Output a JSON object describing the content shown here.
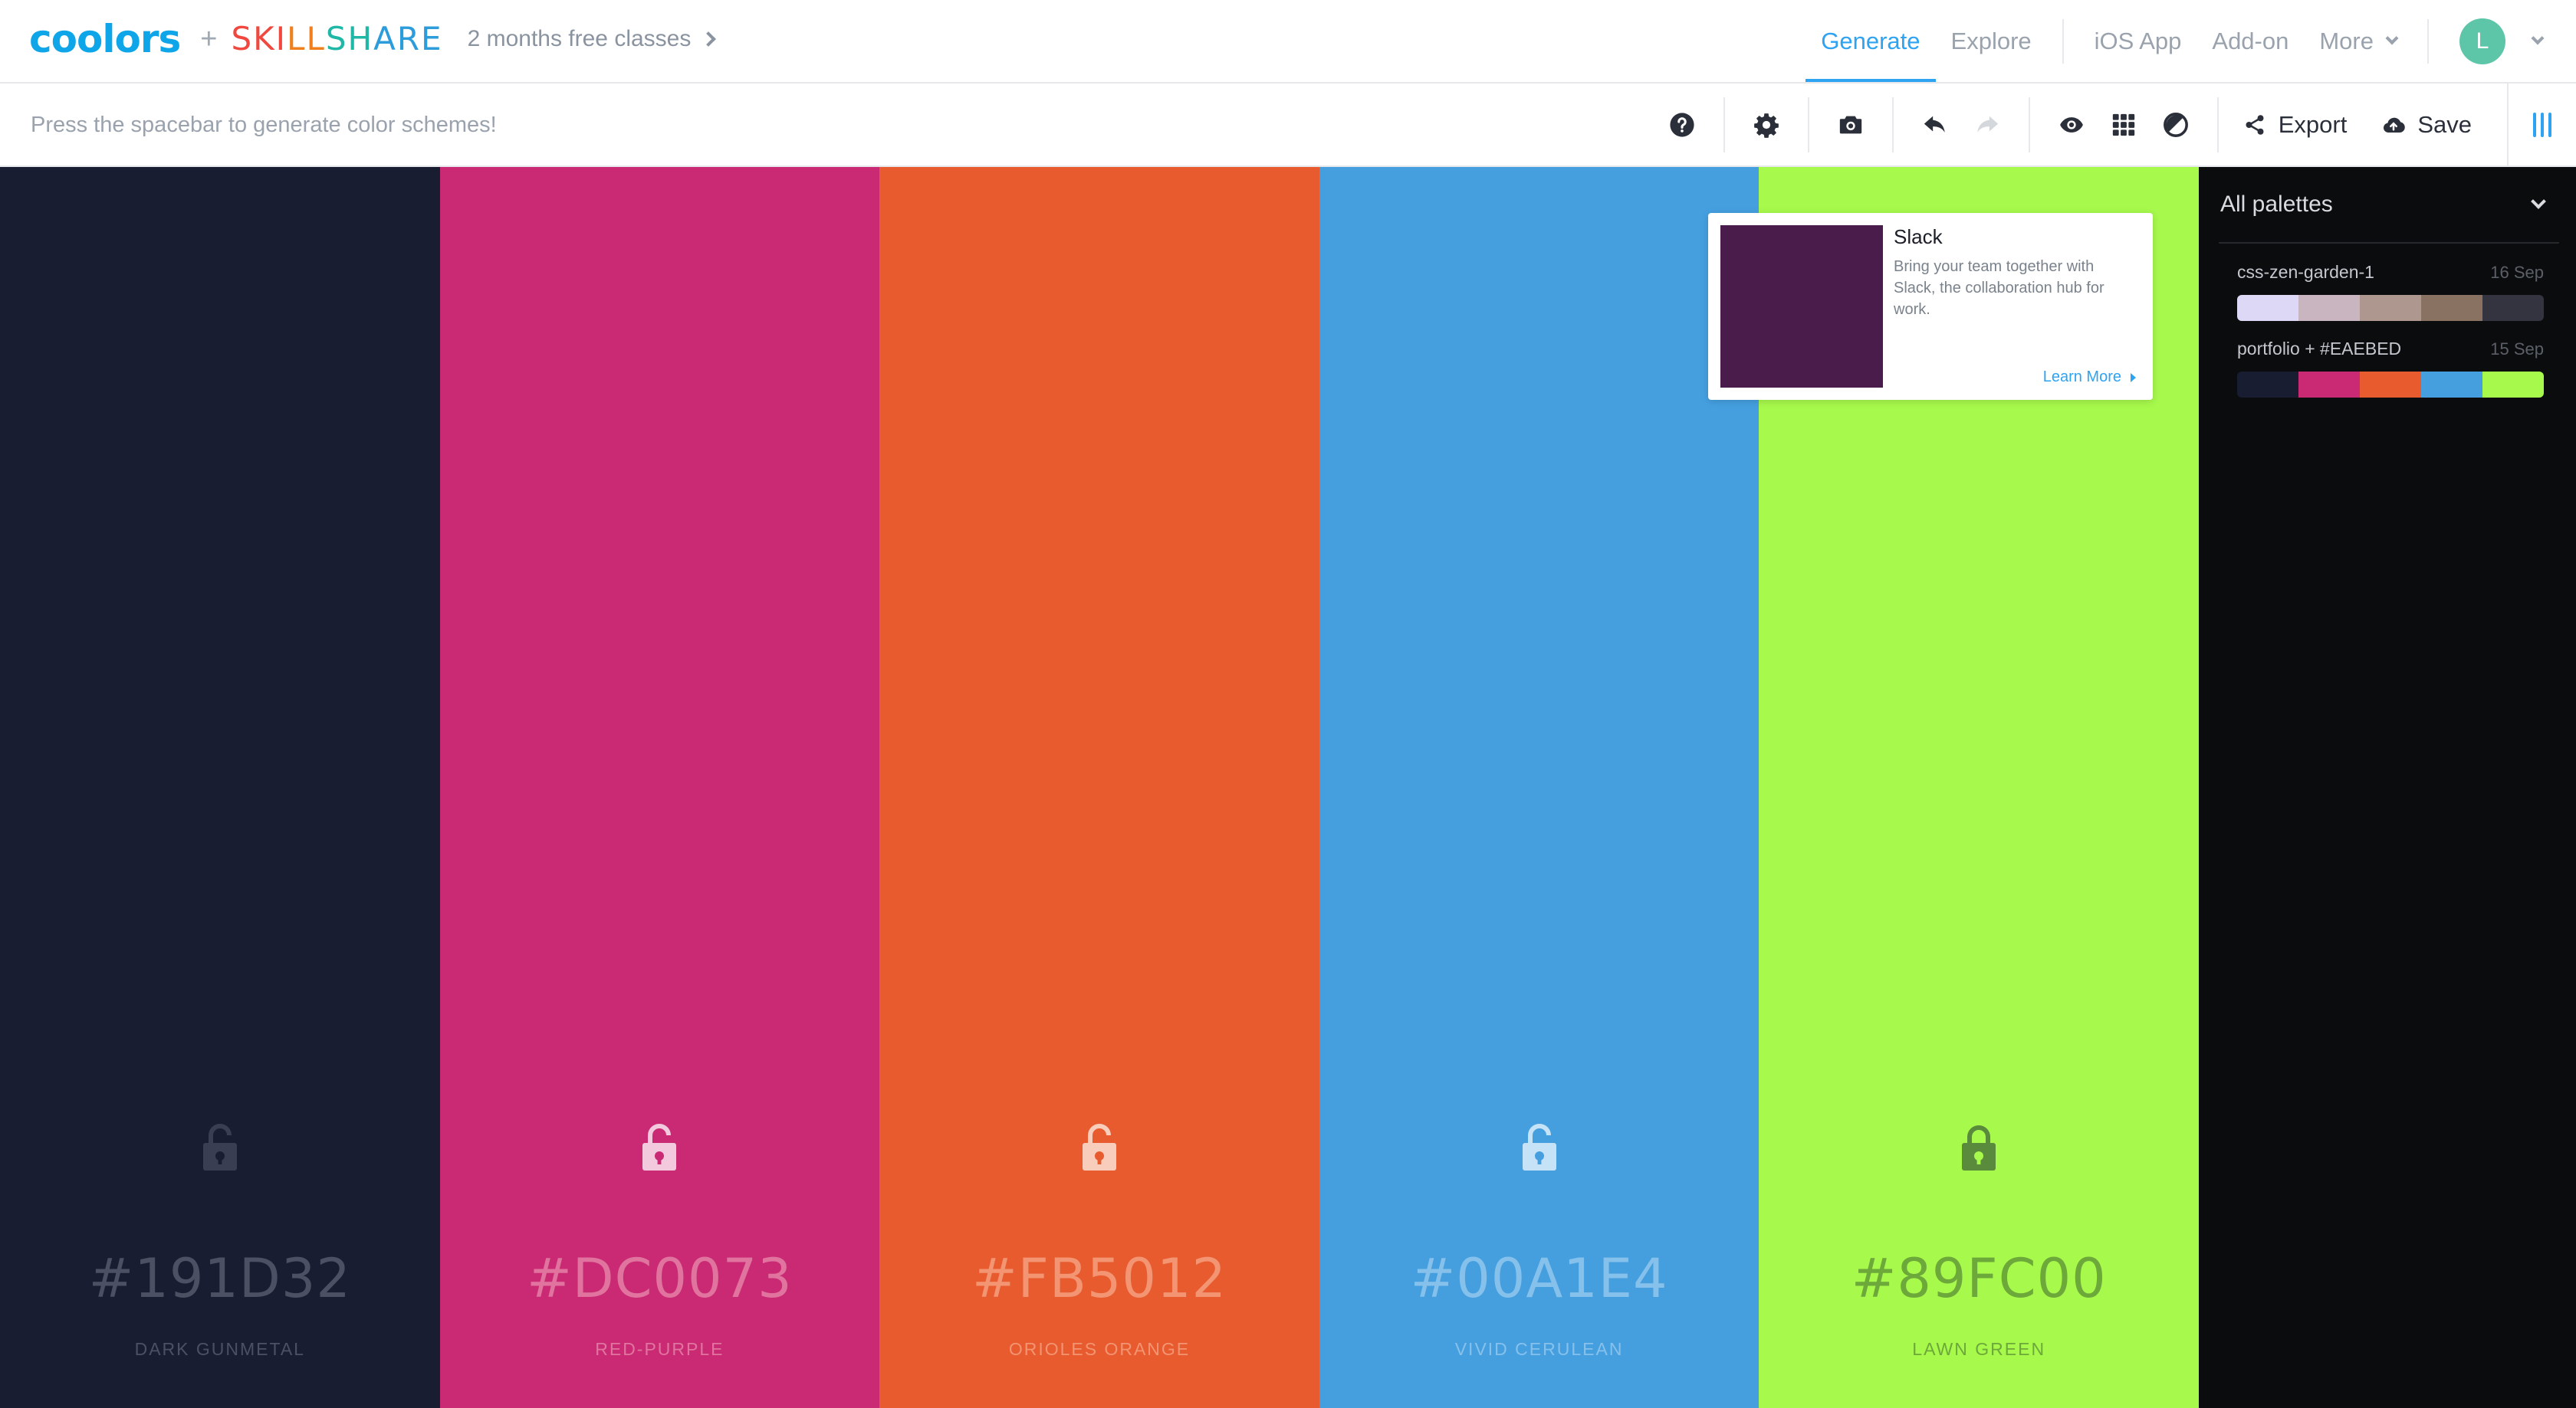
{
  "header": {
    "logo_text": "coolors",
    "plus": "+",
    "partner_letters": [
      "SKI",
      "LL",
      "SH",
      "ARE"
    ],
    "promo_text": "2 months free classes",
    "nav": [
      {
        "label": "Generate",
        "active": true
      },
      {
        "label": "Explore",
        "active": false
      }
    ],
    "links": [
      "iOS App",
      "Add-on"
    ],
    "more_label": "More",
    "avatar_initial": "L"
  },
  "toolbar": {
    "hint": "Press the spacebar to generate color schemes!",
    "icons": [
      "help-icon",
      "settings-icon",
      "camera-icon",
      "undo-icon",
      "redo-icon",
      "view-icon",
      "grid-icon",
      "adjust-icon"
    ],
    "export_label": "Export",
    "save_label": "Save"
  },
  "palette": [
    {
      "hex": "#191D32",
      "name": "DARK GUNMETAL",
      "bg": "#191d32",
      "text_color": "#4c5063",
      "locked": false,
      "lock_color": "#3a3e53"
    },
    {
      "hex": "#DC0073",
      "name": "RED-PURPLE",
      "bg": "#c92a73",
      "text_color": "#e0749f",
      "locked": false,
      "lock_color": "#f2c9dd"
    },
    {
      "hex": "#FB5012",
      "name": "ORIOLES ORANGE",
      "bg": "#e75b2e",
      "text_color": "#f39473",
      "locked": false,
      "lock_color": "#f8cdbb"
    },
    {
      "hex": "#00A1E4",
      "name": "VIVID CERULEAN",
      "bg": "#459fdf",
      "text_color": "#86c1ec",
      "locked": false,
      "lock_color": "#c6e2f6"
    },
    {
      "hex": "#89FC00",
      "name": "LAWN GREEN",
      "bg": "#a7f94c",
      "text_color": "#6da83a",
      "locked": true,
      "lock_color": "#5a8a3c"
    }
  ],
  "ad": {
    "title": "Slack",
    "text": "Bring your team together with Slack, the collaboration hub for work.",
    "link": "Learn More",
    "image_color": "#4a1c4c"
  },
  "sidebar": {
    "title": "All palettes",
    "palettes": [
      {
        "name": "css-zen-garden-1",
        "date": "16 Sep",
        "colors": [
          "#dcd8f5",
          "#c8b5bf",
          "#ad978f",
          "#8a7263",
          "#343340"
        ]
      },
      {
        "name": "portfolio + #EAEBED",
        "date": "15 Sep",
        "colors": [
          "#191d32",
          "#c92a73",
          "#e75b2e",
          "#459fdf",
          "#a7f94c"
        ]
      }
    ]
  }
}
